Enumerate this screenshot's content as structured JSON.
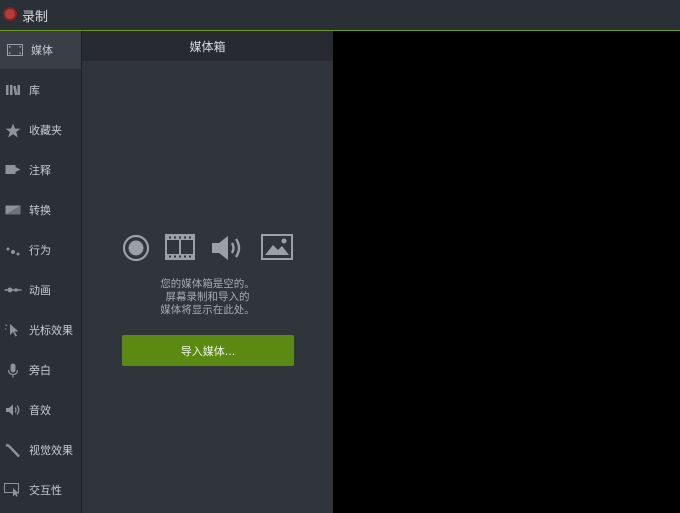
{
  "window": {
    "title": "录制"
  },
  "sidebar": {
    "items": [
      {
        "label": "媒体",
        "icon": "filmstrip-icon"
      },
      {
        "label": "库",
        "icon": "library-books-icon"
      },
      {
        "label": "收藏夹",
        "icon": "star-icon"
      },
      {
        "label": "注释",
        "icon": "annotation-icon"
      },
      {
        "label": "转换",
        "icon": "transition-icon"
      },
      {
        "label": "行为",
        "icon": "behavior-dots-icon"
      },
      {
        "label": "动画",
        "icon": "animation-icon"
      },
      {
        "label": "光标效果",
        "icon": "cursor-effect-icon"
      },
      {
        "label": "旁白",
        "icon": "microphone-icon"
      },
      {
        "label": "音效",
        "icon": "speaker-icon"
      },
      {
        "label": "视觉效果",
        "icon": "magic-wand-icon"
      },
      {
        "label": "交互性",
        "icon": "interactive-icon"
      }
    ]
  },
  "media_bin": {
    "title": "媒体箱",
    "empty_lines": [
      "您的媒体箱是空的。",
      "屏幕录制和导入的",
      "媒体将显示在此处。"
    ],
    "import_button": "导入媒体..."
  },
  "colors": {
    "accent_green": "#5b8a12",
    "record_red": "#b73b3b"
  }
}
